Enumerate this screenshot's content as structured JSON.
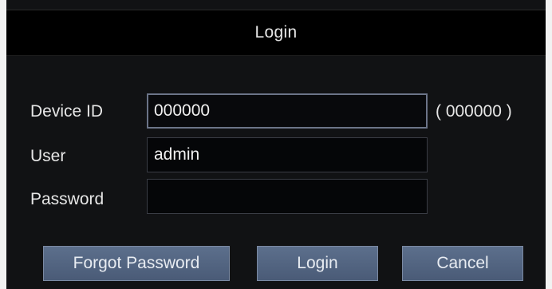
{
  "dialog": {
    "title": "Login"
  },
  "form": {
    "device_id": {
      "label": "Device ID",
      "value": "000000",
      "hint": "( 000000 )"
    },
    "user": {
      "label": "User",
      "value": "admin"
    },
    "password": {
      "label": "Password",
      "value": ""
    }
  },
  "buttons": {
    "forgot_password": "Forgot Password",
    "login": "Login",
    "cancel": "Cancel"
  },
  "colors": {
    "button_bg": "#56698a",
    "field_bg": "#050608",
    "title_bg": "#000000"
  }
}
